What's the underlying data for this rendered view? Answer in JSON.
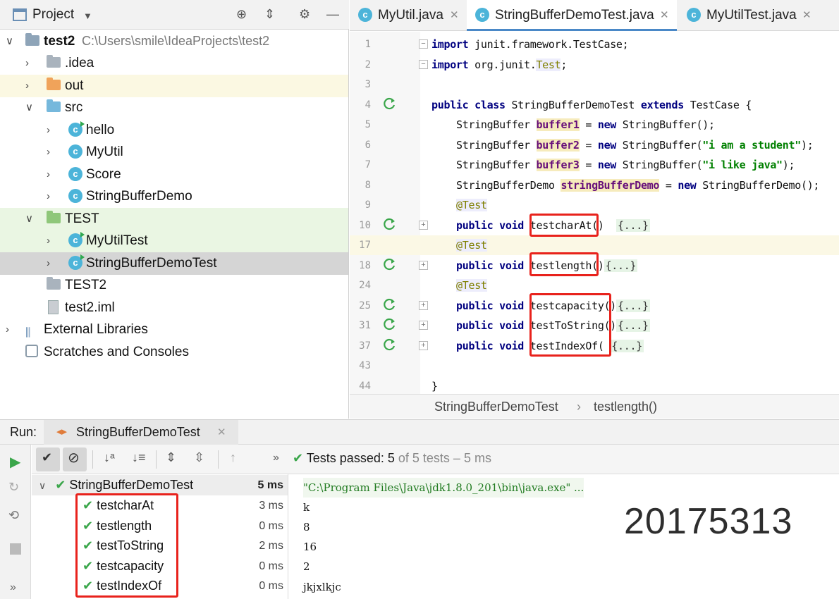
{
  "project": {
    "title": "Project",
    "tree": [
      {
        "label": "test2",
        "path": "C:\\Users\\smile\\IdeaProjects\\test2"
      },
      {
        "label": ".idea"
      },
      {
        "label": "out"
      },
      {
        "label": "src"
      },
      {
        "label": "hello"
      },
      {
        "label": "MyUtil"
      },
      {
        "label": "Score"
      },
      {
        "label": "StringBufferDemo"
      },
      {
        "label": "TEST"
      },
      {
        "label": "MyUtilTest"
      },
      {
        "label": "StringBufferDemoTest"
      },
      {
        "label": "TEST2"
      },
      {
        "label": "test2.iml"
      },
      {
        "label": "External Libraries"
      },
      {
        "label": "Scratches and Consoles"
      }
    ]
  },
  "editor": {
    "tabs": [
      {
        "label": "MyUtil.java"
      },
      {
        "label": "StringBufferDemoTest.java"
      },
      {
        "label": "MyUtilTest.java"
      }
    ],
    "line_numbers": [
      "1",
      "2",
      "3",
      "4",
      "5",
      "6",
      "7",
      "8",
      "9",
      "10",
      "17",
      "18",
      "24",
      "25",
      "31",
      "37",
      "43",
      "44"
    ],
    "code": {
      "l1_kw": "import",
      "l1_rest": " junit.framework.TestCase;",
      "l2_kw": "import",
      "l2_rest": " org.junit.",
      "l2_ann": "Test",
      "l2_end": ";",
      "l4_kw1": "public class",
      "l4_name": " StringBufferDemoTest ",
      "l4_kw2": "extends",
      "l4_rest": " TestCase {",
      "l5_type": "StringBuffer ",
      "l5_fld": "buffer1",
      "l5_eq": " = ",
      "l5_kw": "new",
      "l5_rest": " StringBuffer();",
      "l6_type": "StringBuffer ",
      "l6_fld": "buffer2",
      "l6_eq": " = ",
      "l6_kw": "new",
      "l6_mid": " StringBuffer(",
      "l6_str": "\"i am a student\"",
      "l6_end": ");",
      "l7_type": "StringBuffer ",
      "l7_fld": "buffer3",
      "l7_eq": " = ",
      "l7_kw": "new",
      "l7_mid": " StringBuffer(",
      "l7_str": "\"i like java\"",
      "l7_end": ");",
      "l8_type": "StringBufferDemo ",
      "l8_fld": "stringBufferDemo",
      "l8_eq": " = ",
      "l8_kw": "new",
      "l8_rest": " StringBufferDemo();",
      "ann": "@Test",
      "pv": "public void",
      "m1": "testcharAt",
      "m1_end": "()",
      "m2": "testlength",
      "m2_end": "()",
      "m3": "testcapacity",
      "m3_end": "()",
      "m4": "testToString",
      "m4_end": "()",
      "m5": "testIndexOf",
      "m5_end": "(",
      "folded": "{...}",
      "closing": "}"
    },
    "breadcrumb": {
      "class": "StringBufferDemoTest",
      "sep": "›",
      "method": "testlength()"
    }
  },
  "run": {
    "label": "Run:",
    "tab": "StringBufferDemoTest",
    "status_prefix": "Tests passed:",
    "status_count": "5",
    "status_rest": "of 5 tests – 5 ms",
    "more": "»",
    "tests": [
      {
        "name": "StringBufferDemoTest",
        "duration": "5 ms"
      },
      {
        "name": "testcharAt",
        "duration": "3 ms"
      },
      {
        "name": "testlength",
        "duration": "0 ms"
      },
      {
        "name": "testToString",
        "duration": "2 ms"
      },
      {
        "name": "testcapacity",
        "duration": "0 ms"
      },
      {
        "name": "testIndexOf",
        "duration": "0 ms"
      }
    ],
    "console": [
      "\"C:\\Program Files\\Java\\jdk1.8.0_201\\bin\\java.exe\" ...",
      "k",
      "8",
      "16",
      "2",
      "jkjxlkjc"
    ],
    "watermark": "20175313"
  },
  "colors": {
    "accent": "#4a88c7",
    "pass": "#3aa64a",
    "highlight_box": "#e8221c"
  }
}
